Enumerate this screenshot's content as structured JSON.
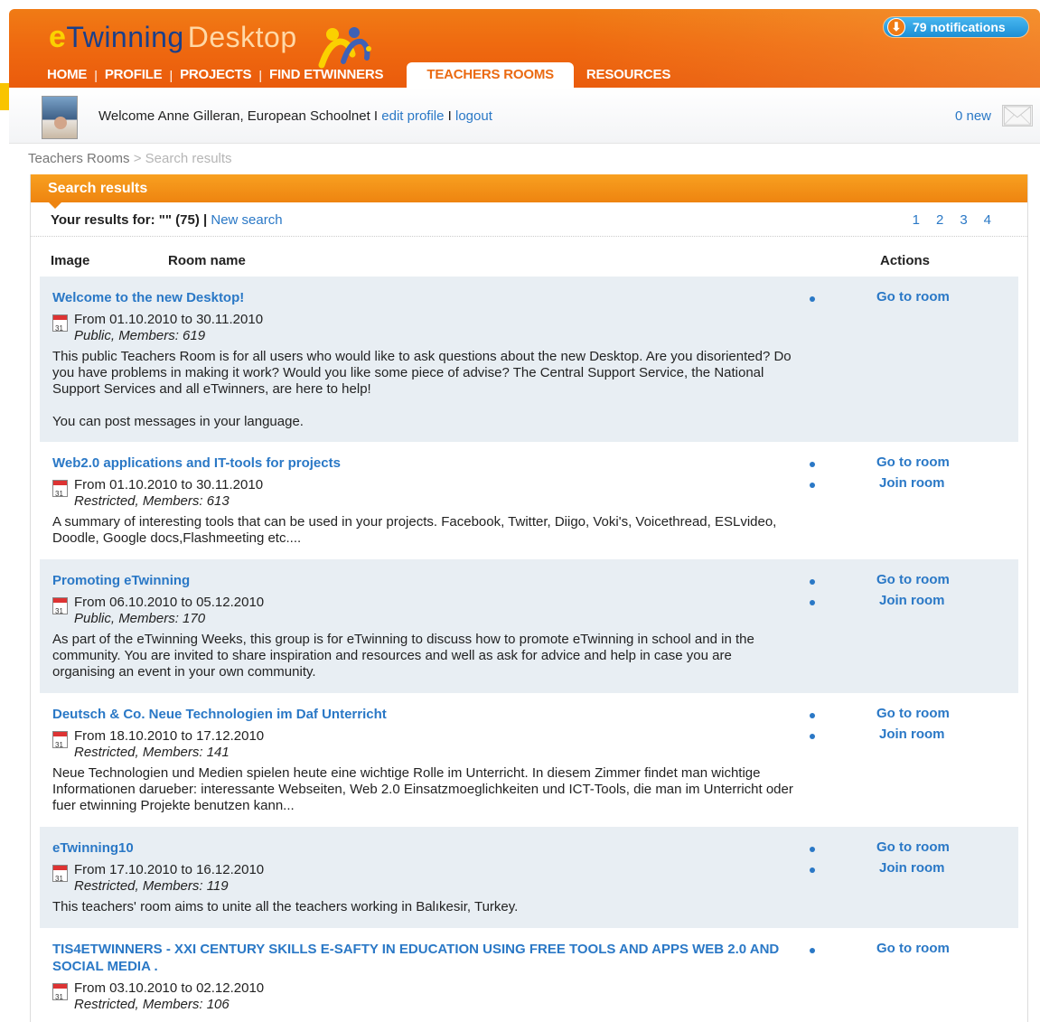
{
  "header": {
    "logo_e": "e",
    "logo_twinning": "Twinning",
    "logo_desktop": "Desktop",
    "notifications": "79 notifications",
    "nav": [
      {
        "label": "HOME"
      },
      {
        "label": "PROFILE"
      },
      {
        "label": "PROJECTS"
      },
      {
        "label": "FIND ETWINNERS"
      },
      {
        "label": "TEACHERS ROOMS"
      },
      {
        "label": "RESOURCES"
      }
    ]
  },
  "userbar": {
    "welcome": "Welcome Anne Gilleran, European Schoolnet",
    "sep1": "I",
    "edit_profile": "edit profile",
    "sep2": "I",
    "logout": "logout",
    "new_messages": "0 new"
  },
  "breadcrumb": {
    "parent": "Teachers Rooms",
    "sep": ">",
    "current": "Search results"
  },
  "panel": {
    "title": "Search results",
    "results_label": "Your results for:",
    "results_query": "\"\" (75)",
    "results_sep": "|",
    "new_search": "New search",
    "pages": [
      "1",
      "2",
      "3",
      "4"
    ],
    "col_image": "Image",
    "col_room": "Room name",
    "col_actions": "Actions"
  },
  "rooms": [
    {
      "title": "Welcome to the new Desktop!",
      "dates": "From 01.10.2010 to 30.11.2010",
      "access": "Public, Members: 619",
      "desc": [
        "This public Teachers Room is for all users who would like to ask questions about the new Desktop. Are you disoriented? Do you have problems in making it work? Would you like some piece of advise? The Central Support Service, the National Support Services and all eTwinners, are here to help!",
        "You can post messages in your language."
      ],
      "go": "Go to room"
    },
    {
      "title": "Web2.0 applications and IT-tools for projects",
      "dates": "From 01.10.2010 to 30.11.2010",
      "access": "Restricted, Members: 613",
      "desc": [
        "A summary of interesting tools that can be used in your projects. Facebook, Twitter, Diigo, Voki's, Voicethread, ESLvideo, Doodle, Google docs,Flashmeeting etc...."
      ],
      "go": "Go to room",
      "join": "Join room"
    },
    {
      "title": "Promoting eTwinning",
      "dates": "From 06.10.2010 to 05.12.2010",
      "access": "Public, Members: 170",
      "desc": [
        "As part of the eTwinning Weeks, this group is for eTwinning to discuss how to promote eTwinning in school and in the community. You are invited to share inspiration and resources and well as ask for advice and help in case you are organising an event in your own community."
      ],
      "go": "Go to room",
      "join": "Join room"
    },
    {
      "title": "Deutsch & Co. Neue Technologien im Daf Unterricht",
      "dates": "From 18.10.2010 to 17.12.2010",
      "access": "Restricted, Members: 141",
      "desc": [
        "Neue Technologien und Medien spielen heute eine wichtige Rolle im Unterricht. In diesem Zimmer findet man wichtige Informationen darueber: interessante Webseiten, Web 2.0 Einsatzmoeglichkeiten und ICT-Tools, die man im Unterricht oder fuer etwinning Projekte benutzen kann..."
      ],
      "go": "Go to room",
      "join": "Join room"
    },
    {
      "title": "eTwinning10",
      "dates": "From 17.10.2010 to 16.12.2010",
      "access": "Restricted, Members: 119",
      "desc": [
        "This teachers' room aims to unite all the teachers working in Balıkesir, Turkey."
      ],
      "go": "Go to room",
      "join": "Join room"
    },
    {
      "title": "TIS4ETWINNERS - XXI CENTURY SKILLS E-SAFTY IN EDUCATION USING FREE TOOLS AND APPS WEB 2.0 AND SOCIAL MEDIA .",
      "dates": "From 03.10.2010 to 02.12.2010",
      "access": "Restricted, Members: 106",
      "desc": [],
      "go": "Go to room"
    }
  ]
}
